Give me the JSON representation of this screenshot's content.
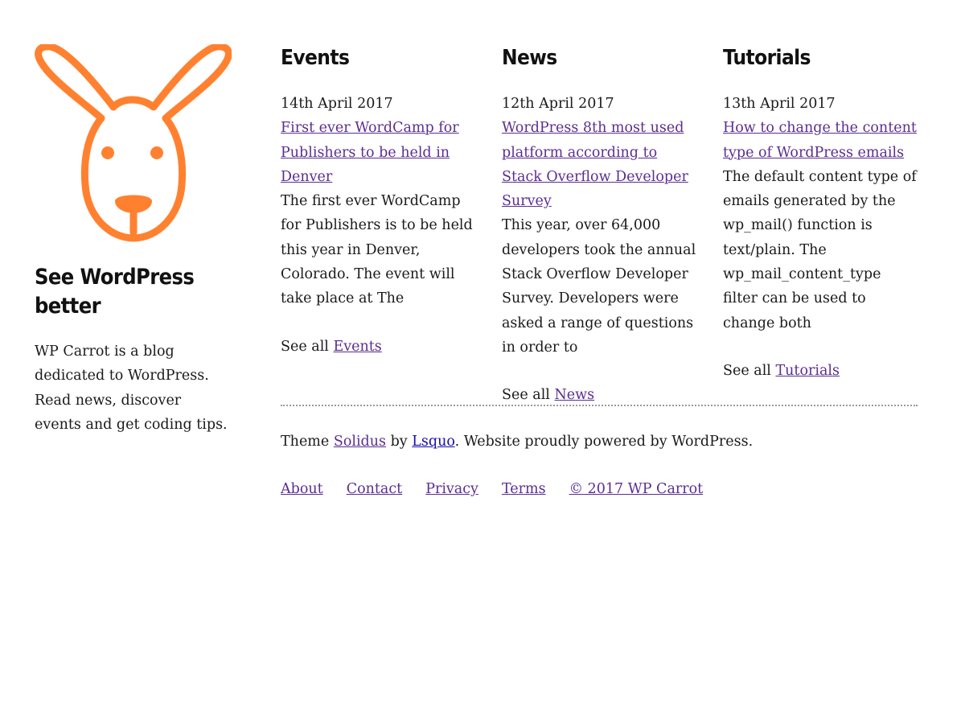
{
  "site": {
    "title": "See WordPress better",
    "description": "WP Carrot is a blog dedicated to WordPress. Read news, discover events and get coding tips.",
    "logo_icon": "kangaroo-logo-icon",
    "accent_color": "#ff8130",
    "link_color": "#5c2d91"
  },
  "columns": [
    {
      "heading": "Events",
      "date": "14th April 2017",
      "post_title": "First ever WordCamp for Publishers to be held in Denver",
      "excerpt": "The first ever WordCamp for Publishers is to be held this year in Denver, Colorado. The event will take place at The",
      "see_all_prefix": "See all",
      "see_all_link": "Events"
    },
    {
      "heading": "News",
      "date": "12th April 2017",
      "post_title": "WordPress 8th most used platform according to Stack Overflow Developer Survey",
      "excerpt": "This year, over 64,000 developers took the annual Stack Overflow Developer Survey. Developers were asked a range of questions in order to",
      "see_all_prefix": "See all",
      "see_all_link": "News"
    },
    {
      "heading": "Tutorials",
      "date": "13th April 2017",
      "post_title": "How to change the content type of WordPress emails",
      "excerpt": "The default content type of emails generated by the wp_mail() function is text/plain. The wp_mail_content_type filter can be used to change both",
      "see_all_prefix": "See all",
      "see_all_link": "Tutorials"
    }
  ],
  "footer": {
    "credit_prefix": "Theme",
    "theme_link": "Solidus",
    "credit_by": "by",
    "author_link": "Lsquo",
    "credit_suffix": ". Website proudly powered by WordPress.",
    "nav": [
      "About",
      "Contact",
      "Privacy",
      "Terms",
      "© 2017 WP Carrot"
    ]
  }
}
